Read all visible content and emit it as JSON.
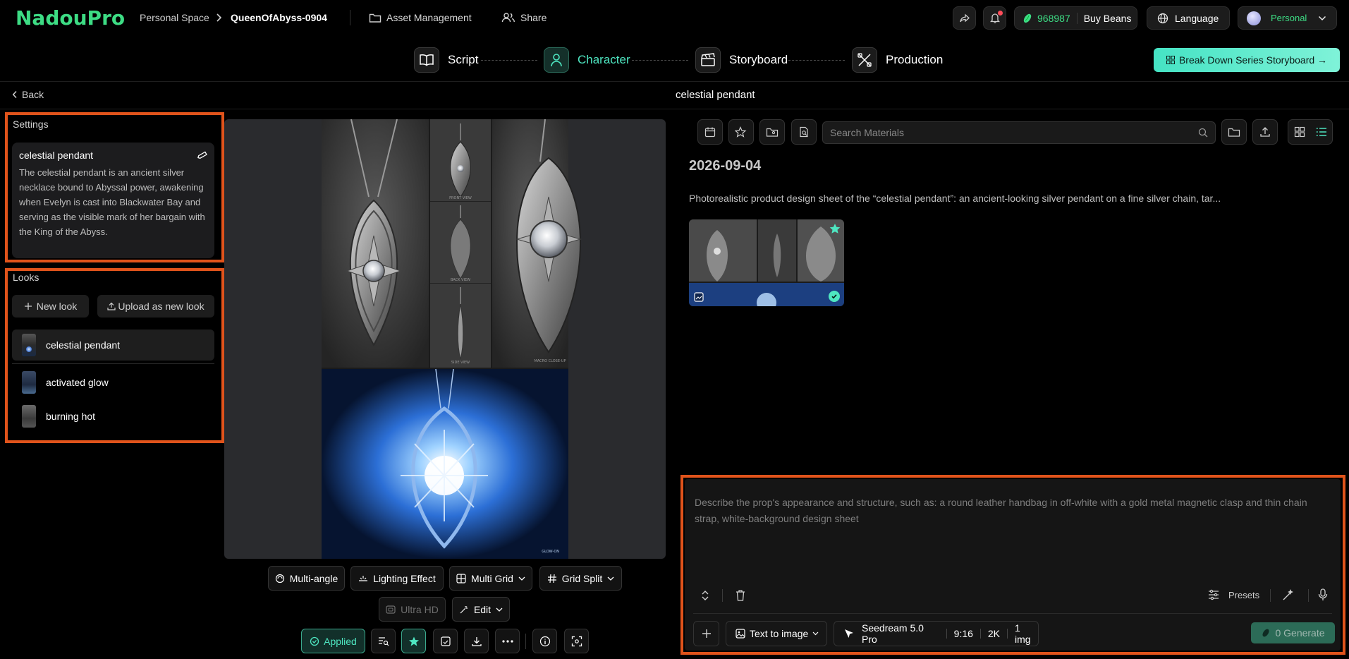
{
  "app": {
    "logo": "NadouPro"
  },
  "breadcrumb": {
    "space": "Personal Space",
    "project": "QueenOfAbyss-0904"
  },
  "top_nav": {
    "asset_management": "Asset Management",
    "share": "Share"
  },
  "header_right": {
    "beans_count": "968987",
    "buy_beans": "Buy Beans",
    "language": "Language",
    "account": "Personal"
  },
  "steps": [
    {
      "label": "Script",
      "icon": "book-icon"
    },
    {
      "label": "Character",
      "icon": "user-icon",
      "active": true
    },
    {
      "label": "Storyboard",
      "icon": "clapperboard-icon"
    },
    {
      "label": "Production",
      "icon": "tools-icon"
    }
  ],
  "cta": {
    "label": "Break Down Series Storyboard →"
  },
  "subheader": {
    "back": "Back",
    "title": "celestial pendant"
  },
  "settings": {
    "label": "Settings",
    "name": "celestial pendant",
    "description": "The celestial pendant is an ancient silver necklace bound to Abyssal power, awakening when Evelyn is cast into Blackwater Bay and serving as the visible mark of her bargain with the King of the Abyss."
  },
  "looks": {
    "label": "Looks",
    "new_look": "New look",
    "upload_look": "Upload as new look",
    "items": [
      {
        "label": "celestial pendant",
        "selected": true
      },
      {
        "label": "activated glow"
      },
      {
        "label": "burning hot"
      }
    ]
  },
  "sheet_labels": {
    "front": "FRONT VIEW",
    "back": "BACK VIEW",
    "side": "SIDE VIEW",
    "detail": "MACRO CLOSE-UP",
    "glow": "GLOW-ON"
  },
  "canvas_tools": {
    "multi_angle": "Multi-angle",
    "lighting": "Lighting Effect",
    "multi_grid": "Multi Grid",
    "grid_split": "Grid Split",
    "ultra_hd": "Ultra HD",
    "edit": "Edit",
    "applied": "Applied"
  },
  "materials": {
    "search_placeholder": "Search Materials",
    "date": "2026-09-04",
    "prompt": "Photorealistic product design sheet of the “celestial pendant”: an ancient-looking silver pendant on a fine silver chain, tar..."
  },
  "composer": {
    "placeholder": "Describe the prop's appearance and structure, such as: a round leather handbag in off-white with a gold metal magnetic clasp and thin chain strap, white-background design sheet",
    "presets": "Presets",
    "mode": "Text to image",
    "model": "Seedream 5.0 Pro",
    "ratio": "9:16",
    "resolution": "2K",
    "count": "1 img",
    "generate": "0 Generate"
  },
  "colors": {
    "accent": "#4ee6c1",
    "logo": "#3ddc84",
    "highlight": "#e0531b",
    "beans": "#3ddc84"
  }
}
